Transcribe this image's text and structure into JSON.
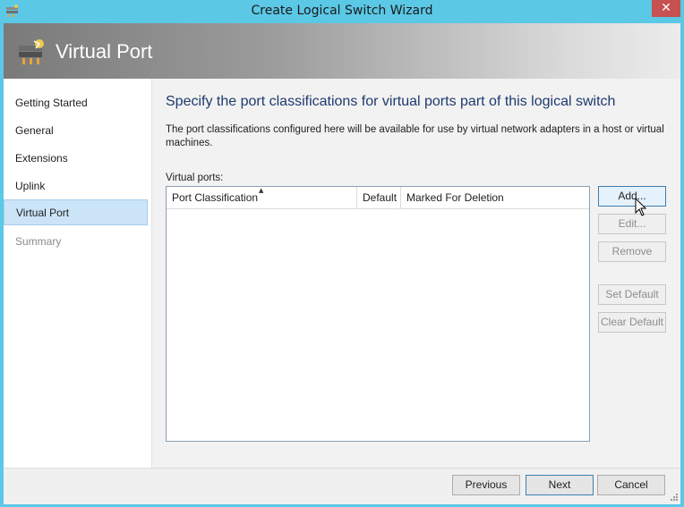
{
  "window": {
    "title": "Create Logical Switch Wizard",
    "close_label": "✕"
  },
  "banner": {
    "title": "Virtual Port"
  },
  "sidebar": {
    "items": [
      {
        "label": "Getting Started"
      },
      {
        "label": "General"
      },
      {
        "label": "Extensions"
      },
      {
        "label": "Uplink"
      },
      {
        "label": "Virtual Port"
      },
      {
        "label": "Summary"
      }
    ],
    "selected": "Virtual Port"
  },
  "content": {
    "heading": "Specify the port classifications for virtual ports part of this logical switch",
    "description": "The port classifications configured here will be available for use by virtual network adapters in a host or virtual machines.",
    "list_label": "Virtual ports:",
    "columns": [
      "Port Classification",
      "Default",
      "Marked For Deletion"
    ],
    "rows": []
  },
  "side_buttons": {
    "add": "Add...",
    "edit": "Edit...",
    "remove": "Remove",
    "set_default": "Set Default",
    "clear_default": "Clear Default"
  },
  "footer": {
    "previous": "Previous",
    "next": "Next",
    "cancel": "Cancel"
  },
  "icons": {
    "app": "switch-icon",
    "banner": "switch-icon",
    "cursor": "mouse-pointer-icon"
  }
}
